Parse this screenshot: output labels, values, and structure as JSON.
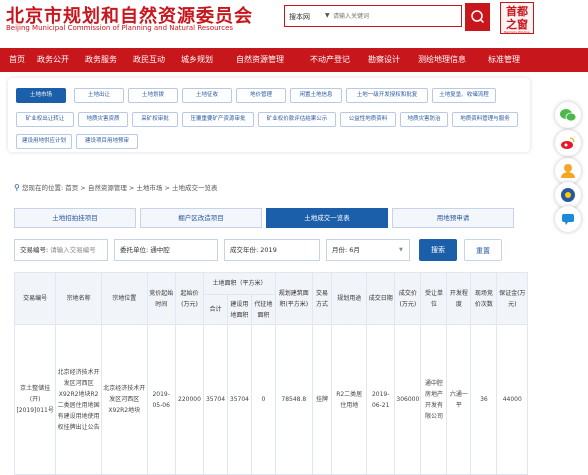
{
  "header": {
    "title_cn": "北京市规划和自然资源委员会",
    "title_en": "Beijing Municipal Commission of Planning and Natural Resources",
    "search_type": "搜本网",
    "search_placeholder": "请输入关键词",
    "emblem_text": "首都之窗",
    "emblem_sub": "Beijing's Window"
  },
  "nav": [
    "首页",
    "政务公开",
    "政务服务",
    "政民互动",
    "城乡规划",
    "自然资源管理",
    "不动产登记",
    "勘察设计",
    "测绘地理信息",
    "标准管理"
  ],
  "subnav": [
    "土地市场",
    "土地出让",
    "土地划拨",
    "土地征收",
    "地价管理",
    "闲置土地信息",
    "土地一级开发授权和批复",
    "土地复垦、收储流程",
    "矿业权出让转让",
    "地质灾害资质",
    "采矿权审批",
    "压覆重要矿产资源审批",
    "矿业权价款评估结果公示",
    "公益性地质资料",
    "地质灾害防治",
    "地质资料管理与服务",
    "建设用地供应计划",
    "建设项目用地预审"
  ],
  "breadcrumb": {
    "prefix": "您现在的位置:",
    "items": [
      "首页",
      "自然资源管理",
      "土地市场",
      "土地成交一览表"
    ]
  },
  "tabs": [
    "土地招拍挂项目",
    "棚户区改造项目",
    "土地成交一览表",
    "用地预申请"
  ],
  "filters": {
    "deal_no_label": "交易编号:",
    "deal_no_placeholder": "请输入交易编号",
    "unit_label": "委托单位:",
    "unit_value": "通中腔",
    "year_label": "成交年份:",
    "year_value": "2019",
    "month_label": "月份:",
    "month_value": "6月",
    "search_btn": "搜索",
    "reset_btn": "重置"
  },
  "table": {
    "headers": [
      "交易编号",
      "宗地名称",
      "宗地位置",
      "竞价起始时间",
      "起始价(万元)",
      "土地面积（平方米）",
      "合计",
      "建设用地面积",
      "代征地面积",
      "规划建筑面积(平方米)",
      "交易方式",
      "规划用途",
      "成交日期",
      "成交价(万元)",
      "受让单位",
      "开发程度",
      "现场竞价次数",
      "保证金(万元)"
    ],
    "rows": [
      [
        "京土整储挂(开)[2019]011号",
        "北京经济技术开发区河西区X92R2地块R2二类居住用地国有建设用地使用权挂牌出让公告",
        "北京经济技术开发区河西区X92R2地块",
        "2019-05-06",
        "220000",
        "35704",
        "35704",
        "0",
        "78548.8",
        "挂牌",
        "R2二类居住用地",
        "2019-06-21",
        "306000",
        "通中腔房地产开发有限公司",
        "六通一平",
        "36",
        "44000"
      ]
    ]
  }
}
